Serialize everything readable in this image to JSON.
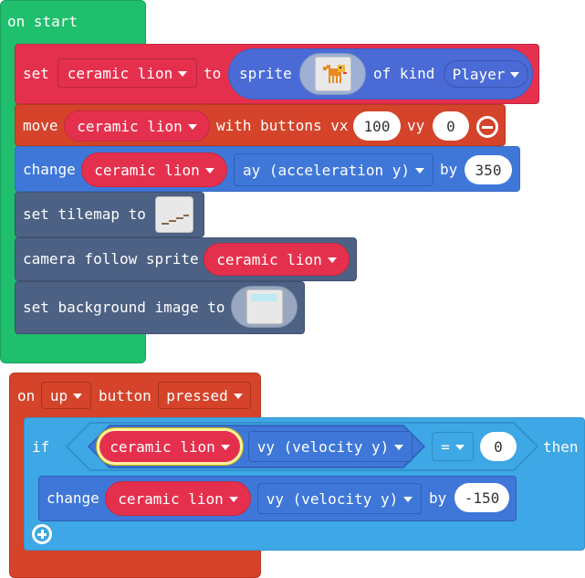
{
  "colors": {
    "events_green": "#1fbf6d",
    "sprites_red": "#e5304d",
    "controller_orange": "#d4432a",
    "scene_slate": "#4c6183",
    "logic_blue": "#3ea7e5",
    "player_kind_blue": "#4a6bd6"
  },
  "on_start": {
    "label": "on start",
    "set_block": {
      "set": "set",
      "variable": "ceramic lion",
      "to": "to",
      "sprite": "sprite",
      "of_kind": "of kind",
      "kind": "Player",
      "sprite_icon": "orange-cat-sprite-icon"
    },
    "move_block": {
      "move": "move",
      "variable": "ceramic lion",
      "with_buttons": "with buttons vx",
      "vx": "100",
      "vy_label": "vy",
      "vy": "0"
    },
    "change_ay_block": {
      "change": "change",
      "variable": "ceramic lion",
      "property": "ay (acceleration y)",
      "by": "by",
      "value": "350"
    },
    "tilemap_block": {
      "label": "set tilemap to",
      "icon": "tilemap-thumbnail-icon"
    },
    "camera_block": {
      "label": "camera follow sprite",
      "variable": "ceramic lion"
    },
    "background_block": {
      "label": "set background image to",
      "icon": "background-thumbnail-icon"
    }
  },
  "on_button": {
    "on": "on",
    "button": "up",
    "button_label": "button",
    "event": "pressed",
    "if_block": {
      "if": "if",
      "variable": "ceramic lion",
      "property": "vy (velocity y)",
      "operator": "=",
      "value": "0",
      "then": "then"
    },
    "change_vy_block": {
      "change": "change",
      "variable": "ceramic lion",
      "property": "vy (velocity y)",
      "by": "by",
      "value": "-150"
    }
  }
}
